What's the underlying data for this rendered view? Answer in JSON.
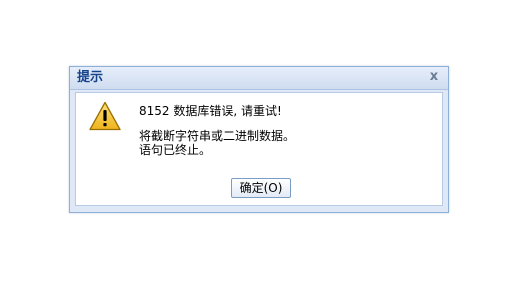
{
  "dialog": {
    "title": "提示",
    "close_glyph": "x",
    "icon": "warning-icon",
    "messages": [
      "8152 数据库错误, 请重试!",
      "将截断字符串或二进制数据。",
      "语句已终止。"
    ],
    "ok_label": "确定(O)"
  },
  "colors": {
    "title_text": "#15428b",
    "frame": "#dfe8f6",
    "border": "#8eb0d4",
    "warning_fill": "#f7c635",
    "warning_outline": "#9a6d00"
  }
}
